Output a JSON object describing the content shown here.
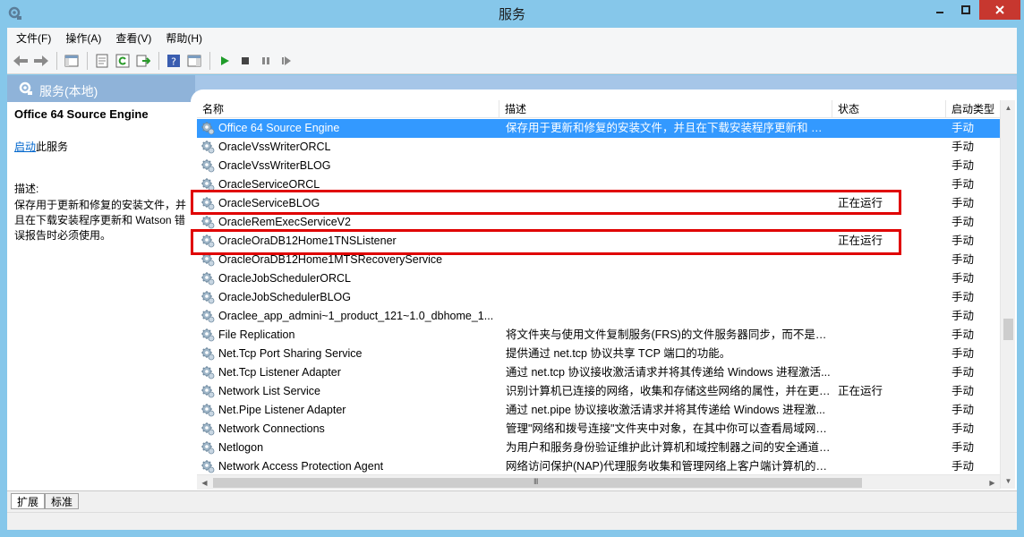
{
  "window": {
    "title": "服务"
  },
  "menu": [
    "文件(F)",
    "操作(A)",
    "查看(V)",
    "帮助(H)"
  ],
  "header": {
    "title": "服务(本地)"
  },
  "left_pane": {
    "service_name": "Office 64 Source Engine",
    "action_link": "启动",
    "action_suffix": "此服务",
    "desc_label": "描述:",
    "description": "保存用于更新和修复的安装文件，并且在下载安装程序更新和 Watson 错误报告时必须使用。"
  },
  "columns": {
    "name": "名称",
    "desc": "描述",
    "status": "状态",
    "startup": "启动类型"
  },
  "rows": [
    {
      "name": "Office 64 Source Engine",
      "desc": "保存用于更新和修复的安装文件，并且在下载安装程序更新和 Wa...",
      "status": "",
      "startup": "手动",
      "selected": true
    },
    {
      "name": "OracleVssWriterORCL",
      "desc": "",
      "status": "",
      "startup": "手动"
    },
    {
      "name": "OracleVssWriterBLOG",
      "desc": "",
      "status": "",
      "startup": "手动"
    },
    {
      "name": "OracleServiceORCL",
      "desc": "",
      "status": "",
      "startup": "手动"
    },
    {
      "name": "OracleServiceBLOG",
      "desc": "",
      "status": "正在运行",
      "startup": "手动",
      "highlighted": true
    },
    {
      "name": "OracleRemExecServiceV2",
      "desc": "",
      "status": "",
      "startup": "手动"
    },
    {
      "name": "OracleOraDB12Home1TNSListener",
      "desc": "",
      "status": "正在运行",
      "startup": "手动",
      "highlighted": true
    },
    {
      "name": "OracleOraDB12Home1MTSRecoveryService",
      "desc": "",
      "status": "",
      "startup": "手动"
    },
    {
      "name": "OracleJobSchedulerORCL",
      "desc": "",
      "status": "",
      "startup": "手动"
    },
    {
      "name": "OracleJobSchedulerBLOG",
      "desc": "",
      "status": "",
      "startup": "手动"
    },
    {
      "name": "Oraclee_app_admini~1_product_121~1.0_dbhome_1...",
      "desc": "",
      "status": "",
      "startup": "手动"
    },
    {
      "name": "File Replication",
      "desc": "将文件夹与使用文件复制服务(FRS)的文件服务器同步，而不是与...",
      "status": "",
      "startup": "手动"
    },
    {
      "name": "Net.Tcp Port Sharing Service",
      "desc": "提供通过 net.tcp 协议共享 TCP 端口的功能。",
      "status": "",
      "startup": "手动"
    },
    {
      "name": "Net.Tcp Listener Adapter",
      "desc": "通过 net.tcp 协议接收激活请求并将其传递给 Windows 进程激活...",
      "status": "",
      "startup": "手动"
    },
    {
      "name": "Network List Service",
      "desc": "识别计算机已连接的网络，收集和存储这些网络的属性，并在更改...",
      "status": "正在运行",
      "startup": "手动"
    },
    {
      "name": "Net.Pipe Listener Adapter",
      "desc": "通过 net.pipe 协议接收激活请求并将其传递给 Windows 进程激...",
      "status": "",
      "startup": "手动"
    },
    {
      "name": "Network Connections",
      "desc": "管理\"网络和拨号连接\"文件夹中对象，在其中你可以查看局域网和...",
      "status": "",
      "startup": "手动"
    },
    {
      "name": "Netlogon",
      "desc": "为用户和服务身份验证维护此计算机和域控制器之间的安全通道。...",
      "status": "",
      "startup": "手动"
    },
    {
      "name": "Network Access Protection Agent",
      "desc": "网络访问保护(NAP)代理服务收集和管理网络上客户端计算机的健...",
      "status": "",
      "startup": "手动"
    }
  ],
  "bottom_tabs": [
    "扩展",
    "标准"
  ],
  "scrollbar": {
    "h_grip": "III"
  },
  "colors": {
    "selection": "#3399ff",
    "highlight_box": "#e00000",
    "window_frame": "#86c7ea"
  },
  "icons": {
    "service": "gear-icon"
  }
}
